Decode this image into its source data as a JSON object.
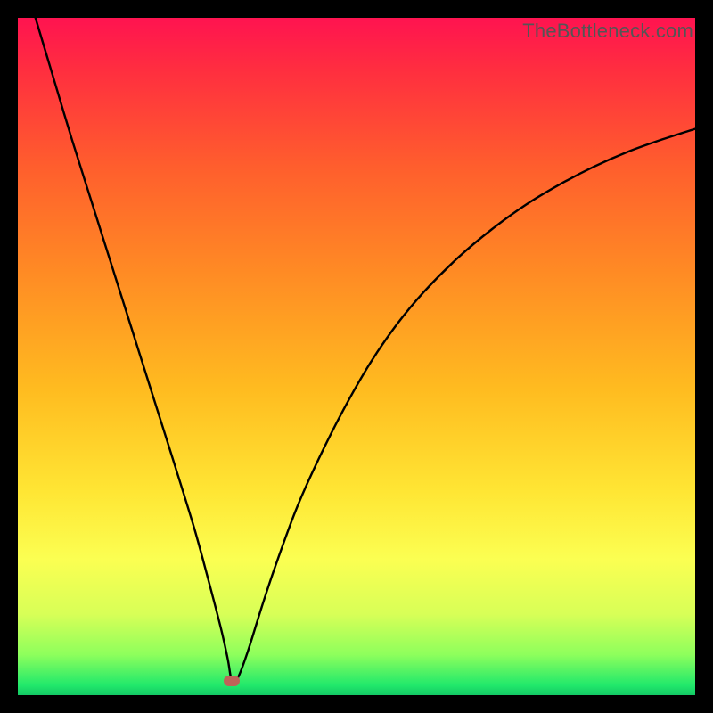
{
  "watermark": "TheBottleneck.com",
  "colors": {
    "bg": "#000000",
    "curve": "#000000",
    "marker": "#be6358",
    "gradient_stops": [
      {
        "offset": 0.0,
        "color": "#ff1350"
      },
      {
        "offset": 0.08,
        "color": "#ff2f3f"
      },
      {
        "offset": 0.22,
        "color": "#ff5e2d"
      },
      {
        "offset": 0.38,
        "color": "#ff8c24"
      },
      {
        "offset": 0.55,
        "color": "#ffbc20"
      },
      {
        "offset": 0.7,
        "color": "#ffe634"
      },
      {
        "offset": 0.8,
        "color": "#fbff52"
      },
      {
        "offset": 0.88,
        "color": "#d8ff57"
      },
      {
        "offset": 0.94,
        "color": "#8eff5c"
      },
      {
        "offset": 0.985,
        "color": "#22e96b"
      },
      {
        "offset": 1.0,
        "color": "#13c965"
      }
    ]
  },
  "chart_data": {
    "type": "line",
    "title": "",
    "xlabel": "",
    "ylabel": "",
    "xlim": [
      0,
      100
    ],
    "ylim": [
      0,
      100
    ],
    "x": [
      2.6,
      5,
      8,
      11,
      14,
      17,
      20,
      23,
      26,
      28,
      30,
      31,
      31.6,
      32.5,
      34,
      36,
      38,
      41,
      44,
      48,
      52,
      56,
      60,
      65,
      70,
      75,
      80,
      85,
      90,
      95,
      100
    ],
    "y": [
      100,
      92,
      82,
      72.5,
      63,
      53.5,
      44,
      34.5,
      24.8,
      17.5,
      9.8,
      5.3,
      2.1,
      2.6,
      6.6,
      13.0,
      19.0,
      27.2,
      34.0,
      42.0,
      49.0,
      54.8,
      59.6,
      64.6,
      68.8,
      72.4,
      75.4,
      78.0,
      80.2,
      82.0,
      83.6
    ],
    "marker": {
      "x": 31.6,
      "y": 2.1
    }
  },
  "layout": {
    "outer": 800,
    "margin": 20,
    "plot": 760
  }
}
